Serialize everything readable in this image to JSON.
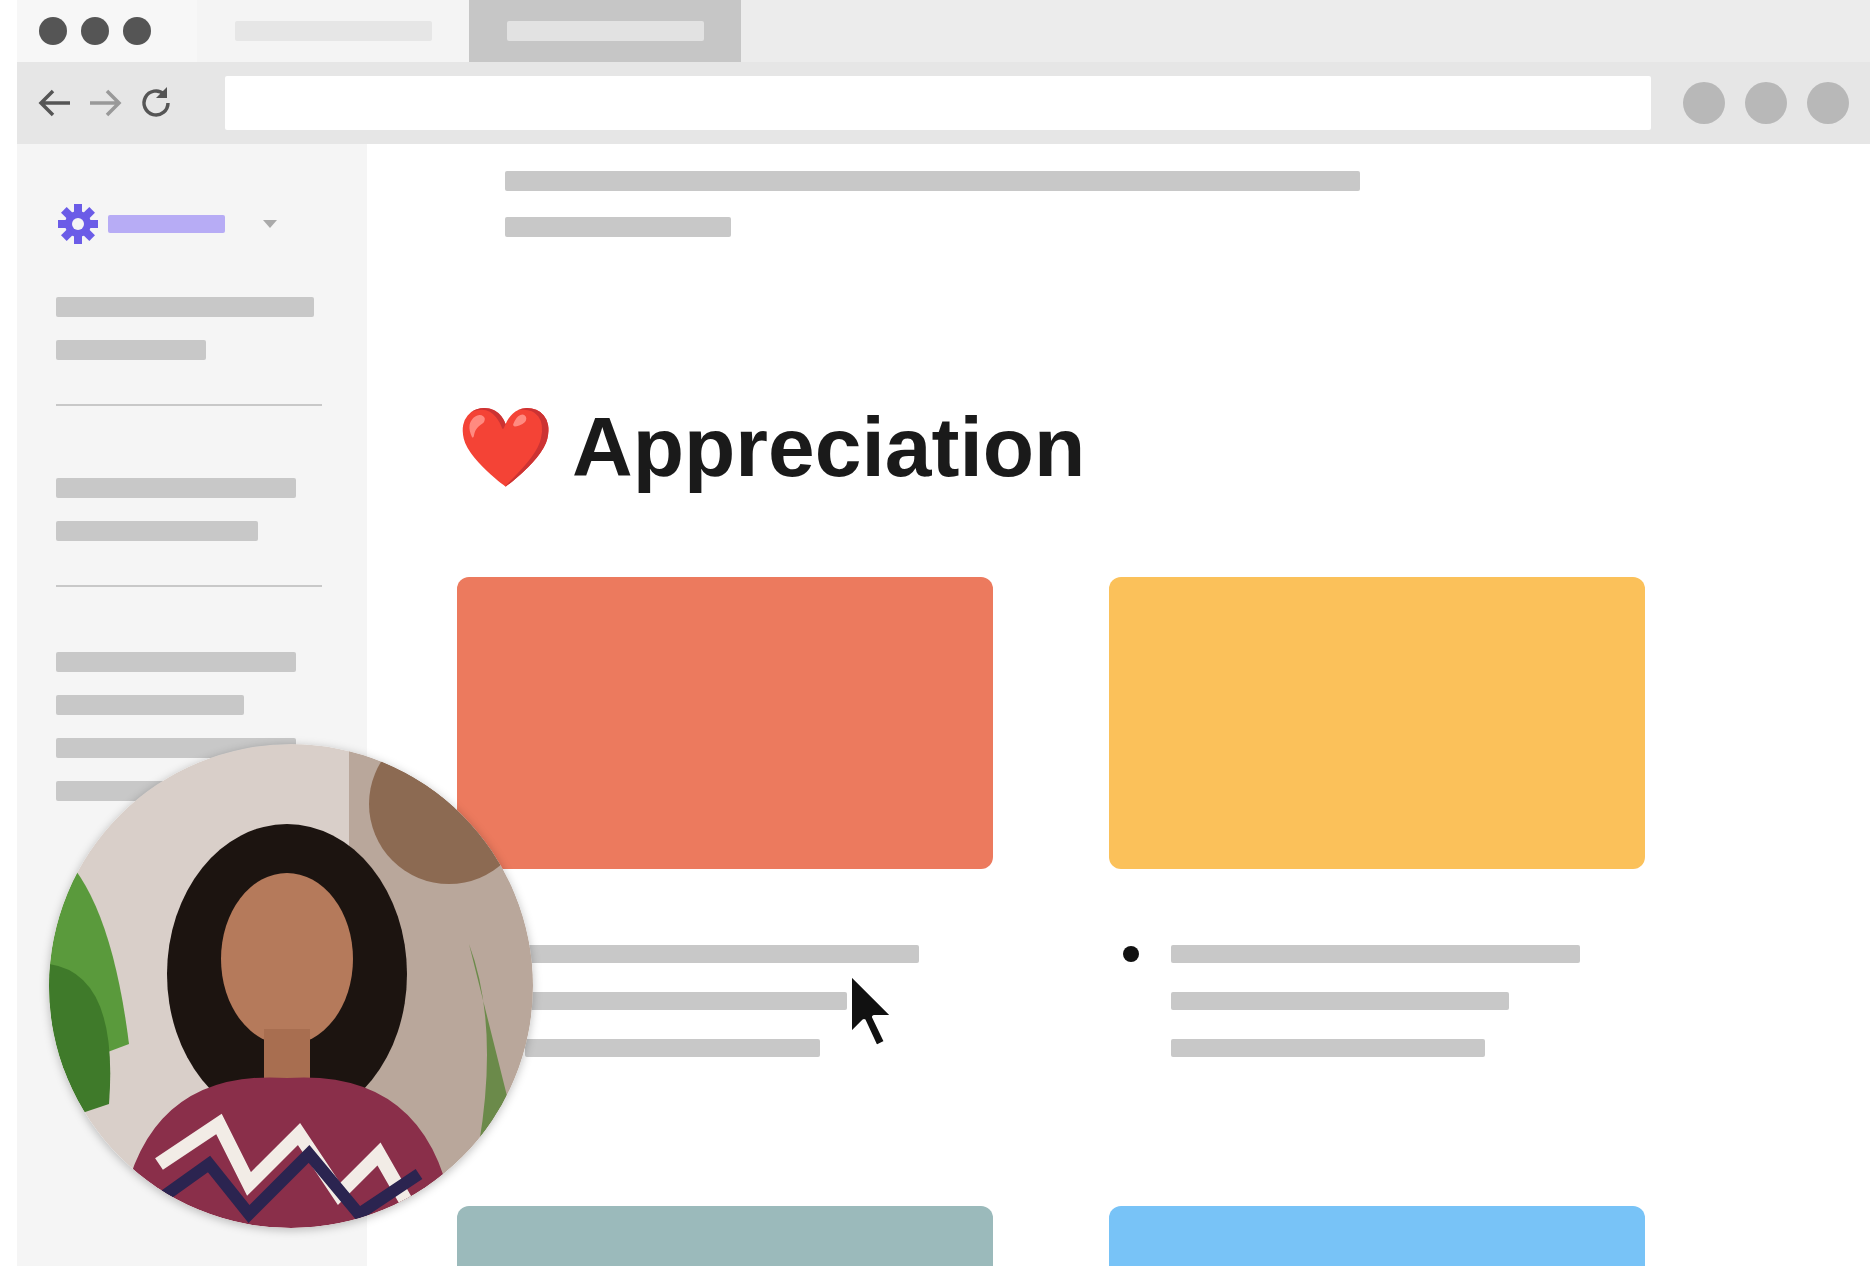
{
  "tabs": [
    {
      "selected": false
    },
    {
      "selected": true
    }
  ],
  "heading": {
    "emoji": "❤️",
    "title": "Appreciation"
  },
  "cards": [
    {
      "color": "#ec7a5e"
    },
    {
      "color": "#fbc15a"
    },
    {
      "color": "#9bbabb"
    },
    {
      "color": "#78c3f7"
    }
  ]
}
